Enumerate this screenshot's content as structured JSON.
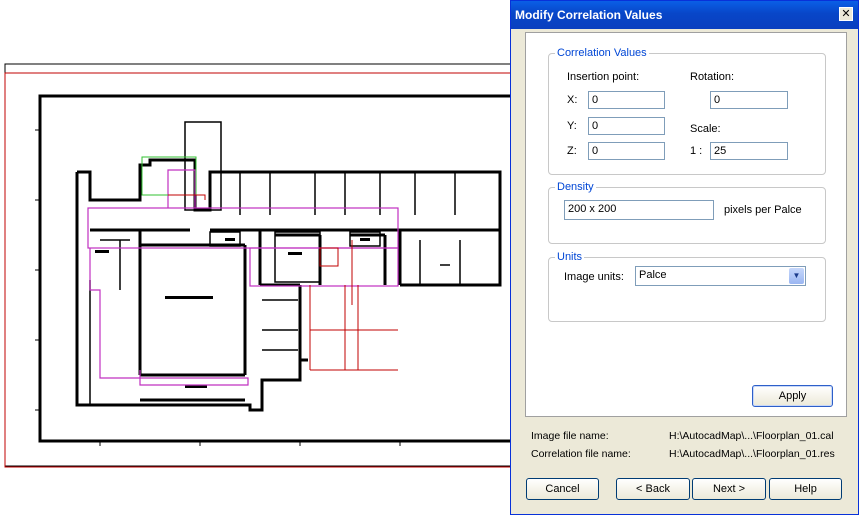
{
  "dialog": {
    "title": "Modify Correlation Values",
    "correlation_group": {
      "legend": "Correlation Values",
      "insertion_point_label": "Insertion point:",
      "x_label": "X:",
      "x_value": "0",
      "y_label": "Y:",
      "y_value": "0",
      "z_label": "Z:",
      "z_value": "0",
      "rotation_label": "Rotation:",
      "rotation_value": "0",
      "scale_label": "Scale:",
      "scale_prefix": "1 :",
      "scale_value": "25"
    },
    "density_group": {
      "legend": "Density",
      "value": "200 x 200",
      "unit_label": "pixels per Palce"
    },
    "units_group": {
      "legend": "Units",
      "image_units_label": "Image units:",
      "image_units_value": "Palce"
    },
    "apply_label": "Apply",
    "image_file_label": "Image file name:",
    "image_file_value": "H:\\AutocadMap\\...\\Floorplan_01.cal",
    "correlation_file_label": "Correlation file name:",
    "correlation_file_value": "H:\\AutocadMap\\...\\Floorplan_01.res",
    "buttons": {
      "cancel": "Cancel",
      "back": "< Back",
      "next": "Next >",
      "help": "Help"
    }
  },
  "colors": {
    "frame_red": "#c00000",
    "boundary_magenta": "#c030c0",
    "boundary_green": "#30c030",
    "wall_black": "#000000"
  }
}
